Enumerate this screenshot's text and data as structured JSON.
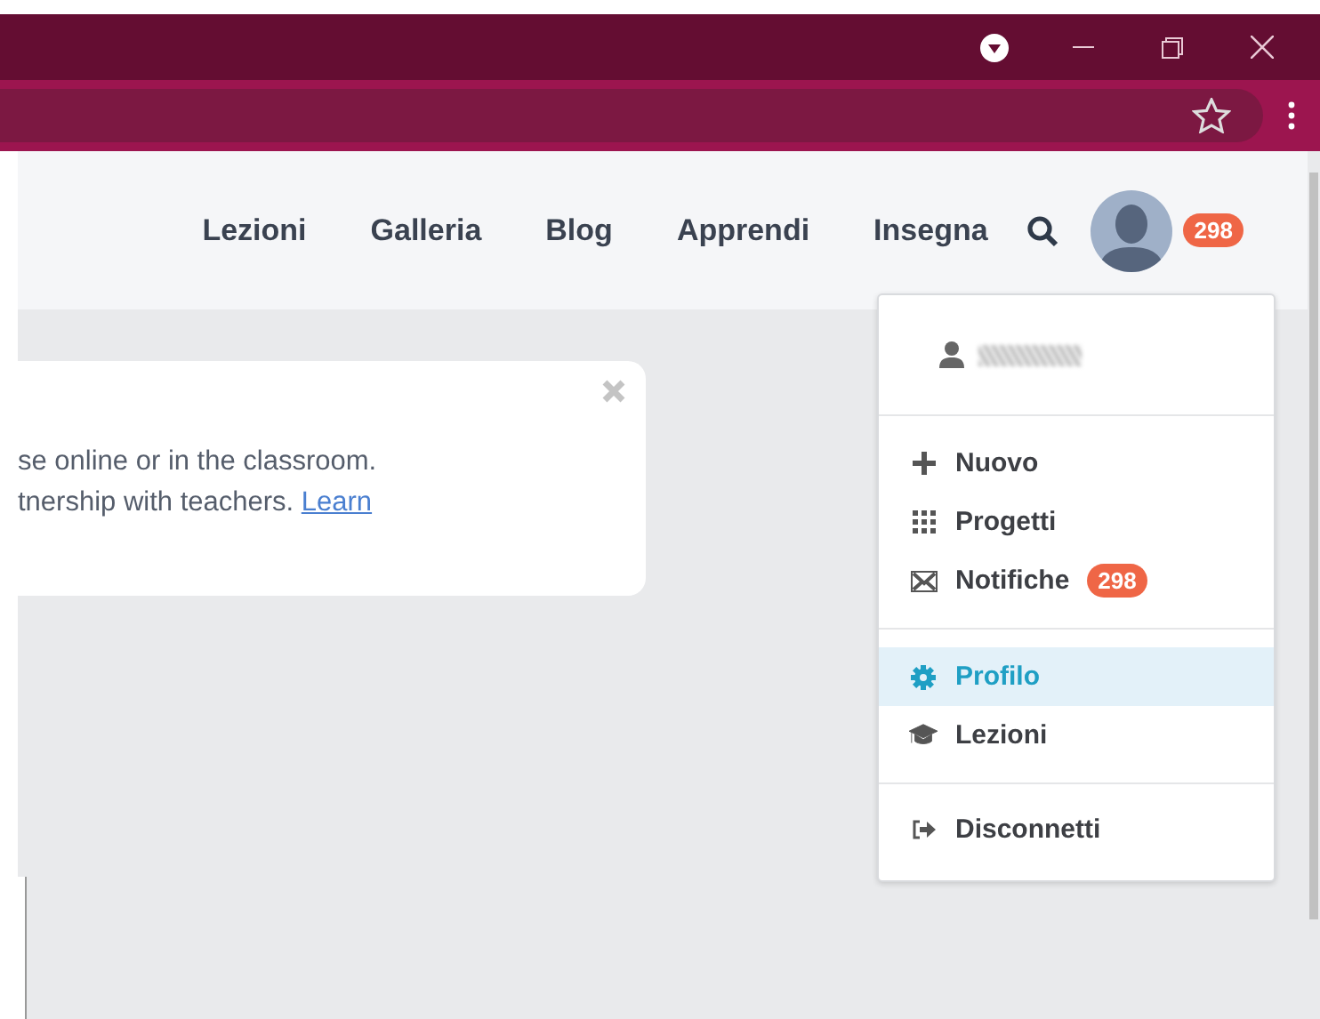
{
  "nav": {
    "items": [
      {
        "label": "Lezioni"
      },
      {
        "label": "Galleria"
      },
      {
        "label": "Blog"
      },
      {
        "label": "Apprendi"
      },
      {
        "label": "Insegna"
      }
    ],
    "badge": "298"
  },
  "card": {
    "lines": [
      "se online or in the classroom.",
      "tnership with teachers."
    ],
    "link": "Learn"
  },
  "menu": {
    "sections": [
      [
        {
          "kind": "plus",
          "label": "Nuovo",
          "selected": false
        },
        {
          "kind": "grid",
          "label": "Progetti",
          "selected": false
        },
        {
          "kind": "mail",
          "label": "Notifiche",
          "badge": "298",
          "selected": false
        }
      ],
      [
        {
          "kind": "gear",
          "label": "Profilo",
          "selected": true
        },
        {
          "kind": "cap",
          "label": "Lezioni",
          "selected": false
        }
      ],
      [
        {
          "kind": "logout",
          "label": "Disconnetti",
          "selected": false
        }
      ]
    ]
  }
}
